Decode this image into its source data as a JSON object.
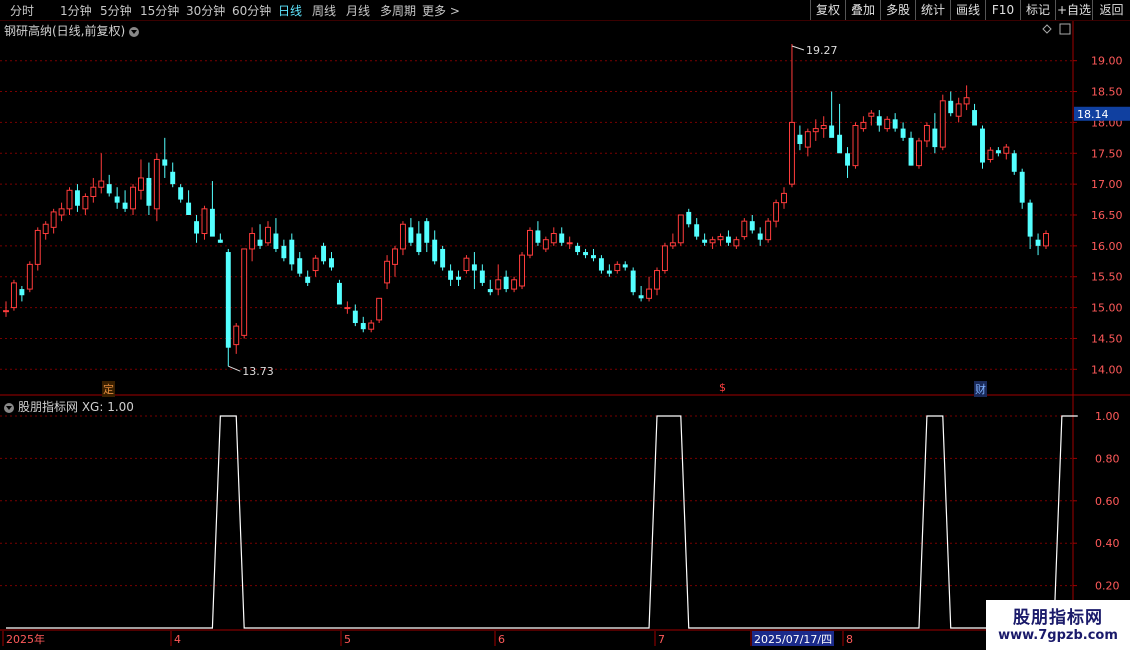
{
  "toolbar": {
    "periods": [
      "分时",
      "1分钟",
      "5分钟",
      "15分钟",
      "30分钟",
      "60分钟",
      "日线",
      "周线",
      "月线",
      "多周期",
      "更多 >"
    ],
    "active": "日线",
    "right_buttons": [
      "复权",
      "叠加",
      "多股",
      "统计",
      "画线",
      "F10",
      "标记",
      "+自选",
      "返回"
    ]
  },
  "main": {
    "title": "钢研高纳(日线,前复权)",
    "high_label": "19.27",
    "low_label": "13.73",
    "current_price": "18.14",
    "price_ticks": [
      "19.00",
      "18.50",
      "18.00",
      "17.50",
      "17.00",
      "16.50",
      "16.00",
      "15.50",
      "15.00",
      "14.50",
      "14.00"
    ],
    "markers": [
      {
        "text": "定",
        "color": "#e08a3c"
      },
      {
        "text": "$",
        "color": "#ff4040"
      },
      {
        "text": "财",
        "color": "#7fb0ff"
      }
    ]
  },
  "indicator": {
    "title": "股朋指标网 XG: 1.00",
    "ticks": [
      "1.00",
      "0.80",
      "0.60",
      "0.40",
      "0.20"
    ]
  },
  "timeline": {
    "labels": [
      "2025年",
      "4",
      "5",
      "6",
      "7",
      "2025/07/17/四",
      "8"
    ]
  },
  "watermark": {
    "line1": "股朋指标网",
    "line2": "www.7gpzb.com"
  },
  "colors": {
    "up": "#ff3c3c",
    "down": "#54ffff",
    "grid": "#7a0000",
    "axis": "#a00000"
  },
  "chart_data": {
    "type": "candlestick",
    "ylim": [
      13.6,
      19.4
    ],
    "candles": [
      [
        14.95,
        15.1,
        14.85,
        14.95
      ],
      [
        15.0,
        15.45,
        14.95,
        15.4
      ],
      [
        15.3,
        15.35,
        15.1,
        15.2
      ],
      [
        15.3,
        15.75,
        15.25,
        15.7
      ],
      [
        15.7,
        16.3,
        15.6,
        16.25
      ],
      [
        16.2,
        16.4,
        16.1,
        16.35
      ],
      [
        16.3,
        16.6,
        16.2,
        16.55
      ],
      [
        16.5,
        16.7,
        16.4,
        16.6
      ],
      [
        16.6,
        16.95,
        16.5,
        16.9
      ],
      [
        16.9,
        17.0,
        16.55,
        16.65
      ],
      [
        16.6,
        16.85,
        16.5,
        16.8
      ],
      [
        16.8,
        17.1,
        16.7,
        16.95
      ],
      [
        16.95,
        17.5,
        16.85,
        17.05
      ],
      [
        17.0,
        17.15,
        16.8,
        16.85
      ],
      [
        16.8,
        16.95,
        16.6,
        16.7
      ],
      [
        16.7,
        16.9,
        16.55,
        16.6
      ],
      [
        16.6,
        17.0,
        16.5,
        16.95
      ],
      [
        16.9,
        17.4,
        16.75,
        17.1
      ],
      [
        17.1,
        17.35,
        16.5,
        16.65
      ],
      [
        16.6,
        17.5,
        16.4,
        17.4
      ],
      [
        17.4,
        17.75,
        17.1,
        17.3
      ],
      [
        17.2,
        17.35,
        16.95,
        17.0
      ],
      [
        16.95,
        17.0,
        16.7,
        16.75
      ],
      [
        16.7,
        16.9,
        16.5,
        16.5
      ],
      [
        16.4,
        16.5,
        16.05,
        16.2
      ],
      [
        16.2,
        16.65,
        16.1,
        16.6
      ],
      [
        16.6,
        17.05,
        16.45,
        16.15
      ],
      [
        16.1,
        16.2,
        16.05,
        16.05
      ],
      [
        15.9,
        15.95,
        14.05,
        14.35
      ],
      [
        14.4,
        14.75,
        14.25,
        14.7
      ],
      [
        14.55,
        15.9,
        14.5,
        15.95
      ],
      [
        15.95,
        16.3,
        15.75,
        16.2
      ],
      [
        16.1,
        16.35,
        15.95,
        16.0
      ],
      [
        16.05,
        16.4,
        16.0,
        16.3
      ],
      [
        16.2,
        16.45,
        15.9,
        15.95
      ],
      [
        16.0,
        16.1,
        15.75,
        15.8
      ],
      [
        16.1,
        16.2,
        15.6,
        15.7
      ],
      [
        15.8,
        15.9,
        15.5,
        15.55
      ],
      [
        15.5,
        15.6,
        15.35,
        15.4
      ],
      [
        15.6,
        15.85,
        15.5,
        15.8
      ],
      [
        16.0,
        16.05,
        15.7,
        15.75
      ],
      [
        15.8,
        15.9,
        15.6,
        15.65
      ],
      [
        15.4,
        15.45,
        15.05,
        15.05
      ],
      [
        15.0,
        15.1,
        14.9,
        15.0
      ],
      [
        14.95,
        15.05,
        14.7,
        14.75
      ],
      [
        14.75,
        14.85,
        14.6,
        14.65
      ],
      [
        14.65,
        14.8,
        14.6,
        14.75
      ],
      [
        14.8,
        15.15,
        14.75,
        15.15
      ],
      [
        15.4,
        15.85,
        15.3,
        15.75
      ],
      [
        15.7,
        16.0,
        15.5,
        15.95
      ],
      [
        15.95,
        16.4,
        15.85,
        16.35
      ],
      [
        16.3,
        16.45,
        16.0,
        16.05
      ],
      [
        16.2,
        16.4,
        15.85,
        15.9
      ],
      [
        16.4,
        16.45,
        15.9,
        16.05
      ],
      [
        16.1,
        16.25,
        15.7,
        15.75
      ],
      [
        15.95,
        16.0,
        15.6,
        15.65
      ],
      [
        15.6,
        15.7,
        15.35,
        15.45
      ],
      [
        15.5,
        15.6,
        15.35,
        15.45
      ],
      [
        15.6,
        15.85,
        15.55,
        15.8
      ],
      [
        15.7,
        15.9,
        15.3,
        15.6
      ],
      [
        15.6,
        15.7,
        15.35,
        15.4
      ],
      [
        15.3,
        15.45,
        15.2,
        15.25
      ],
      [
        15.3,
        15.7,
        15.2,
        15.45
      ],
      [
        15.5,
        15.6,
        15.25,
        15.3
      ],
      [
        15.3,
        15.5,
        15.25,
        15.45
      ],
      [
        15.35,
        15.9,
        15.3,
        15.85
      ],
      [
        15.85,
        16.3,
        15.8,
        16.25
      ],
      [
        16.25,
        16.4,
        16.0,
        16.05
      ],
      [
        15.95,
        16.15,
        15.9,
        16.1
      ],
      [
        16.05,
        16.3,
        16.0,
        16.2
      ],
      [
        16.2,
        16.3,
        16.0,
        16.05
      ],
      [
        16.05,
        16.15,
        15.95,
        16.05
      ],
      [
        16.0,
        16.05,
        15.85,
        15.9
      ],
      [
        15.9,
        15.95,
        15.8,
        15.85
      ],
      [
        15.85,
        15.95,
        15.75,
        15.8
      ],
      [
        15.8,
        15.85,
        15.55,
        15.6
      ],
      [
        15.6,
        15.7,
        15.5,
        15.55
      ],
      [
        15.6,
        15.75,
        15.55,
        15.7
      ],
      [
        15.7,
        15.75,
        15.6,
        15.65
      ],
      [
        15.6,
        15.65,
        15.2,
        15.25
      ],
      [
        15.2,
        15.35,
        15.1,
        15.15
      ],
      [
        15.15,
        15.5,
        15.1,
        15.3
      ],
      [
        15.3,
        15.65,
        15.2,
        15.6
      ],
      [
        15.6,
        16.05,
        15.55,
        16.0
      ],
      [
        16.0,
        16.2,
        15.95,
        16.05
      ],
      [
        16.05,
        16.5,
        16.0,
        16.5
      ],
      [
        16.55,
        16.6,
        16.3,
        16.35
      ],
      [
        16.35,
        16.45,
        16.1,
        16.15
      ],
      [
        16.1,
        16.2,
        16.0,
        16.05
      ],
      [
        16.05,
        16.15,
        15.95,
        16.1
      ],
      [
        16.1,
        16.2,
        16.0,
        16.15
      ],
      [
        16.15,
        16.25,
        16.0,
        16.05
      ],
      [
        16.0,
        16.15,
        15.95,
        16.1
      ],
      [
        16.15,
        16.45,
        16.1,
        16.4
      ],
      [
        16.4,
        16.5,
        16.2,
        16.25
      ],
      [
        16.2,
        16.3,
        16.0,
        16.1
      ],
      [
        16.1,
        16.45,
        16.05,
        16.4
      ],
      [
        16.4,
        16.75,
        16.3,
        16.7
      ],
      [
        16.7,
        16.95,
        16.6,
        16.85
      ],
      [
        17.0,
        19.27,
        16.95,
        18.0
      ],
      [
        17.8,
        17.95,
        17.55,
        17.65
      ],
      [
        17.6,
        17.9,
        17.45,
        17.85
      ],
      [
        17.85,
        18.05,
        17.7,
        17.9
      ],
      [
        17.9,
        18.1,
        17.75,
        17.95
      ],
      [
        17.95,
        18.5,
        17.8,
        17.75
      ],
      [
        17.8,
        18.3,
        17.6,
        17.5
      ],
      [
        17.5,
        17.6,
        17.1,
        17.3
      ],
      [
        17.3,
        18.0,
        17.25,
        17.95
      ],
      [
        17.9,
        18.1,
        17.85,
        18.0
      ],
      [
        18.1,
        18.2,
        17.95,
        18.15
      ],
      [
        18.1,
        18.2,
        17.85,
        17.95
      ],
      [
        17.9,
        18.1,
        17.85,
        18.05
      ],
      [
        18.05,
        18.15,
        17.85,
        17.9
      ],
      [
        17.9,
        18.0,
        17.7,
        17.75
      ],
      [
        17.75,
        17.85,
        17.3,
        17.3
      ],
      [
        17.3,
        17.75,
        17.25,
        17.7
      ],
      [
        17.7,
        18.0,
        17.6,
        17.95
      ],
      [
        17.9,
        18.15,
        17.5,
        17.6
      ],
      [
        17.6,
        18.45,
        17.55,
        18.35
      ],
      [
        18.35,
        18.5,
        18.1,
        18.15
      ],
      [
        18.1,
        18.4,
        18.0,
        18.3
      ],
      [
        18.3,
        18.6,
        18.2,
        18.4
      ],
      [
        18.2,
        18.3,
        17.95,
        17.95
      ],
      [
        17.9,
        17.95,
        17.25,
        17.35
      ],
      [
        17.4,
        17.6,
        17.35,
        17.55
      ],
      [
        17.55,
        17.6,
        17.45,
        17.5
      ],
      [
        17.5,
        17.65,
        17.4,
        17.6
      ],
      [
        17.5,
        17.55,
        17.15,
        17.2
      ],
      [
        17.2,
        17.25,
        16.6,
        16.7
      ],
      [
        16.7,
        16.75,
        15.95,
        16.15
      ],
      [
        16.1,
        16.2,
        15.85,
        16.0
      ],
      [
        16.0,
        16.25,
        15.95,
        16.2
      ]
    ],
    "indicator": {
      "name": "XG",
      "values": [
        0,
        0,
        0,
        0,
        0,
        0,
        0,
        0,
        0,
        0,
        0,
        0,
        0,
        0,
        0,
        0,
        0,
        0,
        0,
        0,
        0,
        0,
        0,
        0,
        0,
        0,
        0,
        1,
        1,
        1,
        0,
        0,
        0,
        0,
        0,
        0,
        0,
        0,
        0,
        0,
        0,
        0,
        0,
        0,
        0,
        0,
        0,
        0,
        0,
        0,
        0,
        0,
        0,
        0,
        0,
        0,
        0,
        0,
        0,
        0,
        0,
        0,
        0,
        0,
        0,
        0,
        0,
        0,
        0,
        0,
        0,
        0,
        0,
        0,
        0,
        0,
        0,
        0,
        0,
        0,
        0,
        0,
        1,
        1,
        1,
        1,
        0,
        0,
        0,
        0,
        0,
        0,
        0,
        0,
        0,
        0,
        0,
        0,
        0,
        0,
        0,
        0,
        0,
        0,
        0,
        0,
        0,
        0,
        0,
        0,
        0,
        0,
        0,
        0,
        0,
        0,
        1,
        1,
        1,
        0,
        0,
        0,
        0,
        0,
        0,
        0,
        0,
        0,
        0,
        0,
        0,
        0,
        0,
        1,
        1,
        1
      ],
      "ylim": [
        0,
        1.0
      ]
    }
  }
}
